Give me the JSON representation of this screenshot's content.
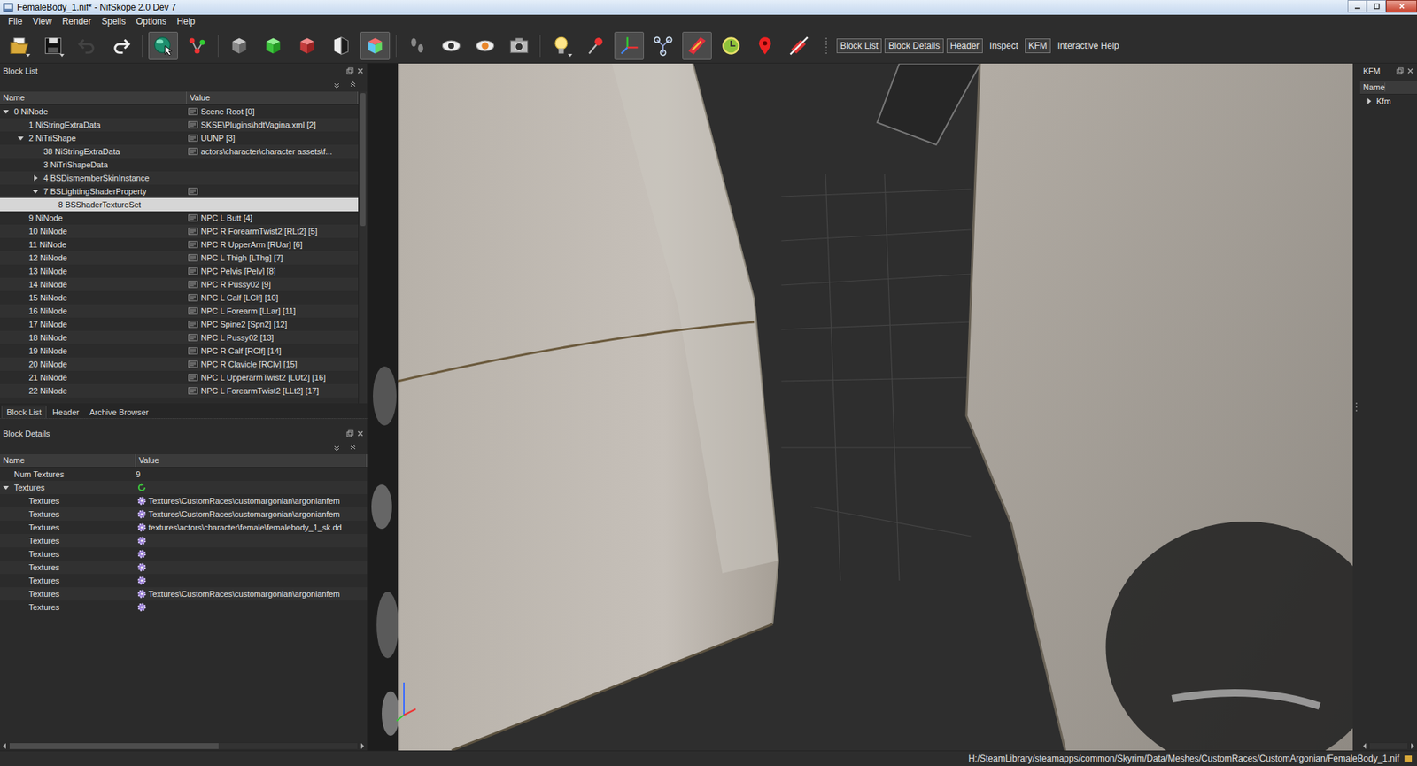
{
  "window": {
    "title": "FemaleBody_1.nif* - NifSkope 2.0 Dev 7"
  },
  "menu": [
    "File",
    "View",
    "Render",
    "Spells",
    "Options",
    "Help"
  ],
  "toolbar": {
    "tools": [
      {
        "selected": false,
        "disabled": false
      },
      {
        "selected": false,
        "disabled": false
      },
      {
        "selected": false,
        "disabled": true
      },
      {
        "selected": false,
        "disabled": false
      },
      {
        "selected": true,
        "disabled": false
      },
      {
        "selected": false,
        "disabled": false
      },
      {
        "selected": false,
        "disabled": false
      },
      {
        "selected": false,
        "disabled": false
      },
      {
        "selected": false,
        "disabled": false
      },
      {
        "selected": false,
        "disabled": false
      },
      {
        "selected": true,
        "disabled": false
      },
      {
        "selected": false,
        "disabled": false
      },
      {
        "selected": false,
        "disabled": false
      },
      {
        "selected": false,
        "disabled": false
      },
      {
        "selected": false,
        "disabled": false
      },
      {
        "selected": false,
        "disabled": false
      },
      {
        "selected": false,
        "disabled": false
      },
      {
        "selected": true,
        "disabled": false
      },
      {
        "selected": false,
        "disabled": false
      },
      {
        "selected": true,
        "disabled": false
      },
      {
        "selected": false,
        "disabled": false
      },
      {
        "selected": false,
        "disabled": false
      },
      {
        "selected": false,
        "disabled": false
      }
    ],
    "toggles": [
      {
        "label": "Block List",
        "selected": true
      },
      {
        "label": "Block Details",
        "selected": true
      },
      {
        "label": "Header",
        "selected": true
      },
      {
        "label": "Inspect",
        "selected": false
      },
      {
        "label": "KFM",
        "selected": true
      },
      {
        "label": "Interactive Help",
        "selected": false
      }
    ]
  },
  "block_list": {
    "title": "Block List",
    "columns": [
      "Name",
      "Value"
    ],
    "rows": [
      {
        "name": "0 NiNode",
        "value": "Scene Root [0]",
        "depth": 0,
        "expandable": true,
        "expanded": true,
        "value_icon": true,
        "selected": false
      },
      {
        "name": "1 NiStringExtraData",
        "value": "SKSE\\Plugins\\hdtVagina.xml [2]",
        "depth": 1,
        "expandable": false,
        "expanded": false,
        "value_icon": true,
        "selected": false
      },
      {
        "name": "2 NiTriShape",
        "value": "UUNP [3]",
        "depth": 1,
        "expandable": true,
        "expanded": true,
        "value_icon": true,
        "selected": false
      },
      {
        "name": "38 NiStringExtraData",
        "value": "actors\\character\\character assets\\f...",
        "depth": 2,
        "expandable": false,
        "expanded": false,
        "value_icon": true,
        "selected": false
      },
      {
        "name": "3 NiTriShapeData",
        "value": "",
        "depth": 2,
        "expandable": false,
        "expanded": false,
        "value_icon": false,
        "selected": false
      },
      {
        "name": "4 BSDismemberSkinInstance",
        "value": "",
        "depth": 2,
        "expandable": true,
        "expanded": false,
        "value_icon": false,
        "selected": false
      },
      {
        "name": "7 BSLightingShaderProperty",
        "value": "",
        "depth": 2,
        "expandable": true,
        "expanded": true,
        "value_icon": true,
        "selected": false
      },
      {
        "name": "8 BSShaderTextureSet",
        "value": "",
        "depth": 3,
        "expandable": false,
        "expanded": false,
        "value_icon": false,
        "selected": true
      },
      {
        "name": "9 NiNode",
        "value": "NPC L Butt [4]",
        "depth": 1,
        "expandable": false,
        "expanded": false,
        "value_icon": true,
        "selected": false
      },
      {
        "name": "10 NiNode",
        "value": "NPC R ForearmTwist2 [RLt2] [5]",
        "depth": 1,
        "expandable": false,
        "expanded": false,
        "value_icon": true,
        "selected": false
      },
      {
        "name": "11 NiNode",
        "value": "NPC R UpperArm [RUar] [6]",
        "depth": 1,
        "expandable": false,
        "expanded": false,
        "value_icon": true,
        "selected": false
      },
      {
        "name": "12 NiNode",
        "value": "NPC L Thigh [LThg] [7]",
        "depth": 1,
        "expandable": false,
        "expanded": false,
        "value_icon": true,
        "selected": false
      },
      {
        "name": "13 NiNode",
        "value": "NPC Pelvis [Pelv] [8]",
        "depth": 1,
        "expandable": false,
        "expanded": false,
        "value_icon": true,
        "selected": false
      },
      {
        "name": "14 NiNode",
        "value": "NPC R Pussy02 [9]",
        "depth": 1,
        "expandable": false,
        "expanded": false,
        "value_icon": true,
        "selected": false
      },
      {
        "name": "15 NiNode",
        "value": "NPC L Calf [LClf] [10]",
        "depth": 1,
        "expandable": false,
        "expanded": false,
        "value_icon": true,
        "selected": false
      },
      {
        "name": "16 NiNode",
        "value": "NPC L Forearm [LLar] [11]",
        "depth": 1,
        "expandable": false,
        "expanded": false,
        "value_icon": true,
        "selected": false
      },
      {
        "name": "17 NiNode",
        "value": "NPC Spine2 [Spn2] [12]",
        "depth": 1,
        "expandable": false,
        "expanded": false,
        "value_icon": true,
        "selected": false
      },
      {
        "name": "18 NiNode",
        "value": "NPC L Pussy02 [13]",
        "depth": 1,
        "expandable": false,
        "expanded": false,
        "value_icon": true,
        "selected": false
      },
      {
        "name": "19 NiNode",
        "value": "NPC R Calf [RClf] [14]",
        "depth": 1,
        "expandable": false,
        "expanded": false,
        "value_icon": true,
        "selected": false
      },
      {
        "name": "20 NiNode",
        "value": "NPC R Clavicle [RClv] [15]",
        "depth": 1,
        "expandable": false,
        "expanded": false,
        "value_icon": true,
        "selected": false
      },
      {
        "name": "21 NiNode",
        "value": "NPC L UpperarmTwist2 [LUt2] [16]",
        "depth": 1,
        "expandable": false,
        "expanded": false,
        "value_icon": true,
        "selected": false
      },
      {
        "name": "22 NiNode",
        "value": "NPC L ForearmTwist2 [LLt2] [17]",
        "depth": 1,
        "expandable": false,
        "expanded": false,
        "value_icon": true,
        "selected": false
      }
    ]
  },
  "left_tabs": [
    {
      "label": "Block List",
      "selected": true
    },
    {
      "label": "Header",
      "selected": false
    },
    {
      "label": "Archive Browser",
      "selected": false
    }
  ],
  "block_details": {
    "title": "Block Details",
    "columns": [
      "Name",
      "Value"
    ],
    "rows": [
      {
        "name": "Num Textures",
        "value": "9",
        "depth": 0,
        "kind": "field",
        "expanded": false
      },
      {
        "name": "Textures",
        "value": "",
        "depth": 0,
        "kind": "array",
        "expanded": true
      },
      {
        "name": "Textures",
        "value": "Textures\\CustomRaces\\customargonian\\argonianfem",
        "depth": 1,
        "kind": "texture",
        "expanded": false
      },
      {
        "name": "Textures",
        "value": "Textures\\CustomRaces\\customargonian\\argonianfem",
        "depth": 1,
        "kind": "texture",
        "expanded": false
      },
      {
        "name": "Textures",
        "value": "textures\\actors\\character\\female\\femalebody_1_sk.dd",
        "depth": 1,
        "kind": "texture",
        "expanded": false
      },
      {
        "name": "Textures",
        "value": "",
        "depth": 1,
        "kind": "texture",
        "expanded": false
      },
      {
        "name": "Textures",
        "value": "",
        "depth": 1,
        "kind": "texture",
        "expanded": false
      },
      {
        "name": "Textures",
        "value": "",
        "depth": 1,
        "kind": "texture",
        "expanded": false
      },
      {
        "name": "Textures",
        "value": "",
        "depth": 1,
        "kind": "texture",
        "expanded": false
      },
      {
        "name": "Textures",
        "value": "Textures\\CustomRaces\\customargonian\\argonianfem",
        "depth": 1,
        "kind": "texture",
        "expanded": false
      },
      {
        "name": "Textures",
        "value": "",
        "depth": 1,
        "kind": "texture",
        "expanded": false
      }
    ]
  },
  "kfm": {
    "title": "KFM",
    "columns": [
      "Name"
    ],
    "rows": [
      {
        "name": "Kfm",
        "expanded": false
      }
    ]
  },
  "status_bar": {
    "path": "H:/SteamLibrary/steamapps/common/Skyrim/Data/Meshes/CustomRaces/CustomArgonian/FemaleBody_1.nif"
  }
}
